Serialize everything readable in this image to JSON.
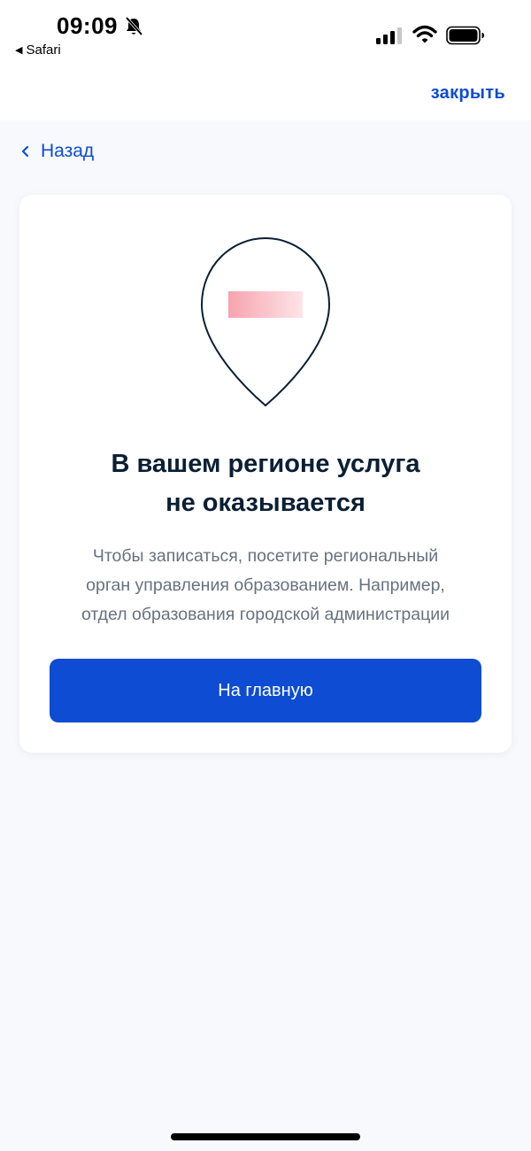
{
  "status_bar": {
    "time": "09:09",
    "back_app_label": "Safari",
    "icons": [
      "bell-muted-icon",
      "signal-icon",
      "wifi-icon",
      "battery-icon"
    ]
  },
  "header": {
    "close_label": "закрыть"
  },
  "nav": {
    "back_label": "Назад"
  },
  "card": {
    "illustration": "map-pin-icon",
    "title_lines": [
      "В вашем регионе услуга",
      "не оказывается"
    ],
    "text_lines": [
      "Чтобы записаться, посетите региональный",
      "орган управления образованием. Например,",
      "отдел образования городской администрации"
    ],
    "button_label": "На главную"
  },
  "colors": {
    "accent": "#0d4cd3",
    "title": "#0b1f33",
    "secondary_text": "#66727f",
    "background": "#f7f9fd",
    "pin_flag": "#f7a4ae"
  }
}
